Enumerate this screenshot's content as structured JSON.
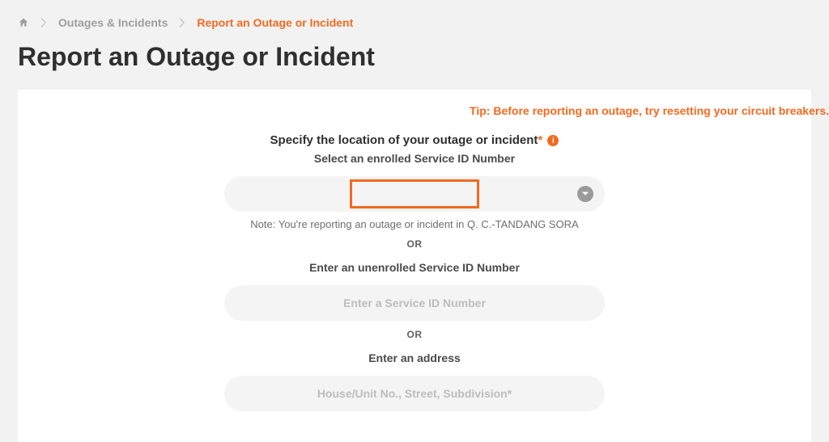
{
  "breadcrumb": {
    "items": [
      {
        "label": "Outages & Incidents"
      },
      {
        "label": "Report an Outage or Incident"
      }
    ]
  },
  "page": {
    "title": "Report an Outage or Incident"
  },
  "tip": {
    "text": "Tip: Before reporting an outage, try resetting your circuit breakers."
  },
  "form": {
    "heading": "Specify the location of your outage or incident",
    "required_mark": "*",
    "enrolled": {
      "label": "Select an enrolled Service ID Number",
      "selected_value": "",
      "note": "Note: You're reporting an outage or incident in Q. C.-TANDANG SORA"
    },
    "or": "OR",
    "unenrolled": {
      "label": "Enter an unenrolled Service ID Number",
      "placeholder": "Enter a Service ID Number",
      "value": ""
    },
    "address": {
      "label": "Enter an address",
      "placeholder": "House/Unit No., Street, Subdivision*",
      "value": ""
    }
  }
}
